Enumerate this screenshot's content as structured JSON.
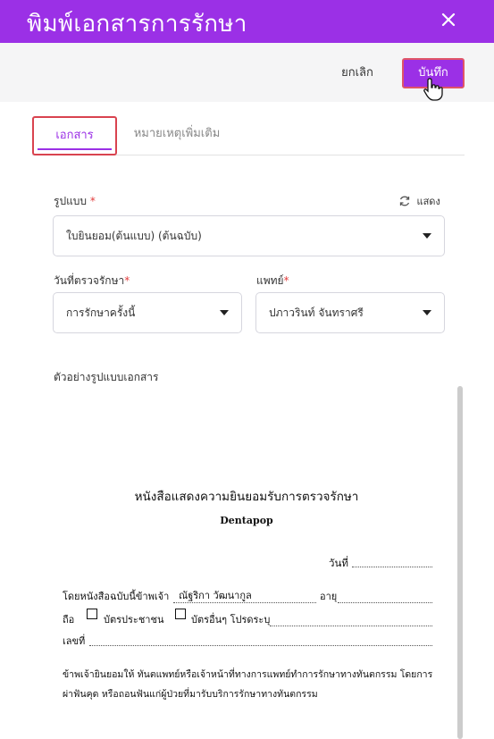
{
  "dialog": {
    "title": "พิมพ์เอกสารการรักษา",
    "close_icon": "close-icon"
  },
  "actions": {
    "cancel_label": "ยกเลิก",
    "save_label": "บันทึก"
  },
  "tabs": [
    {
      "label": "เอกสาร",
      "active": true
    },
    {
      "label": "หมายเหตุเพิ่มเติม",
      "active": false
    }
  ],
  "form": {
    "format_label": "รูปแบบ",
    "required_mark": "*",
    "refresh_label": "แสดง",
    "format_value": "ใบยินยอม(ต้นแบบ) (ต้นฉบับ)",
    "exam_date_label": "วันที่ตรวจรักษา",
    "exam_date_value": "การรักษาครั้งนี้",
    "doctor_label": "แพทย์",
    "doctor_value": "ปภาวรินท์ จันทราศรี"
  },
  "preview": {
    "label": "ตัวอย่างรูปแบบเอกสาร",
    "doc_title": "หนังสือแสดงความยินยอมรับการตรวจรักษา",
    "clinic_name": "Dentapop",
    "date_label": "วันที่",
    "line1_prefix": "โดยหนังสือฉบับนี้ข้าพเจ้า",
    "patient_name": "ณัฐริกา วัฒนากูล",
    "age_label": "อายุ",
    "holder_label": "ถือ",
    "id_card_label": "บัตรประชาชน",
    "other_card_label": "บัตรอื่นๆ โปรดระบุ",
    "number_label": "เลขที่",
    "consent_text": "ข้าพเจ้ายินยอมให้ ทันตแพทย์หรือเจ้าหน้าที่ทางการแพทย์ทำการรักษาทางทันตกรรม โดยการผ่าฟันคุด หรือถอนฟันแก่ผู้ป่วยที่มารับบริการรักษาทางทันตกรรม"
  },
  "colors": {
    "accent": "#9b30e6",
    "highlight_border": "#d9434f",
    "required": "#e23c3c"
  }
}
